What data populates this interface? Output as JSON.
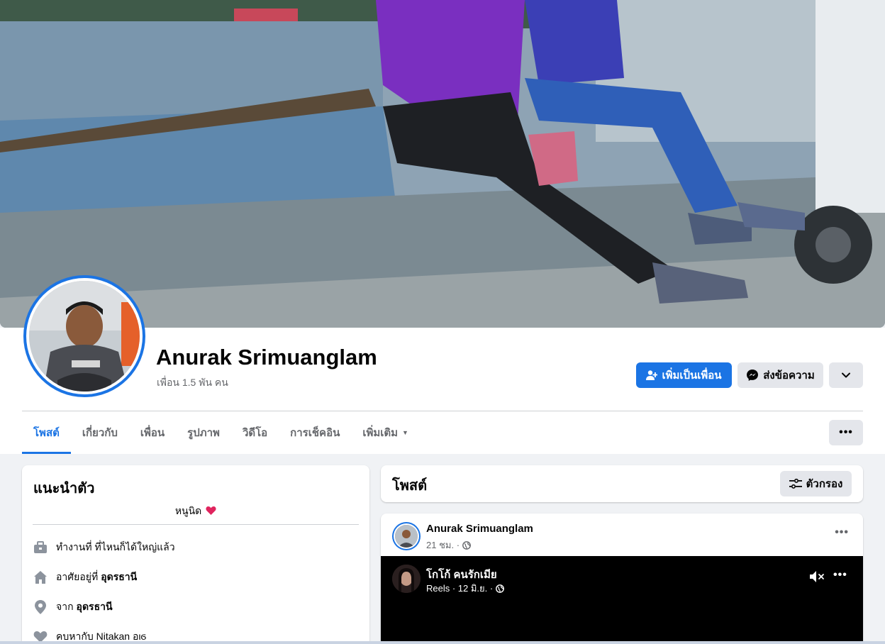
{
  "profile": {
    "name": "Anurak Srimuanglam",
    "friends": "เพื่อน 1.5 พัน คน"
  },
  "actions": {
    "add_friend": "เพิ่มเป็นเพื่อน",
    "message": "ส่งข้อความ"
  },
  "tabs": [
    {
      "label": "โพสต์",
      "active": true
    },
    {
      "label": "เกี่ยวกับ"
    },
    {
      "label": "เพื่อน"
    },
    {
      "label": "รูปภาพ"
    },
    {
      "label": "วิดีโอ"
    },
    {
      "label": "การเช็คอิน"
    },
    {
      "label": "เพิ่มเติม"
    }
  ],
  "intro": {
    "title": "แนะนำตัว",
    "bio": "หนูนิด",
    "items": [
      {
        "icon": "briefcase-icon",
        "text": "ทำงานที่ ที่ไหนก็ได้ใหญ่แล้ว",
        "bold": ""
      },
      {
        "icon": "home-icon",
        "text": "อาศัยอยู่ที่",
        "bold": "อุดรธานี"
      },
      {
        "icon": "location-pin-icon",
        "text": "จาก",
        "bold": "อุดรธานี"
      },
      {
        "icon": "heart-icon",
        "text": "คบหากับ Nitakan อιϭ",
        "bold": ""
      }
    ]
  },
  "posts": {
    "title": "โพสต์",
    "filter": "ตัวกรอง"
  },
  "post": {
    "author": "Anurak Srimuanglam",
    "time": "21 ชม. ·",
    "reel": {
      "name": "โกโก้ คนรักเมีย",
      "meta": "Reels · 12 มิ.ย. ·"
    }
  },
  "colors": {
    "accent": "#1b74e4",
    "background": "#f0f2f5",
    "secondary_button": "#e4e6eb",
    "text_secondary": "#65676b"
  }
}
